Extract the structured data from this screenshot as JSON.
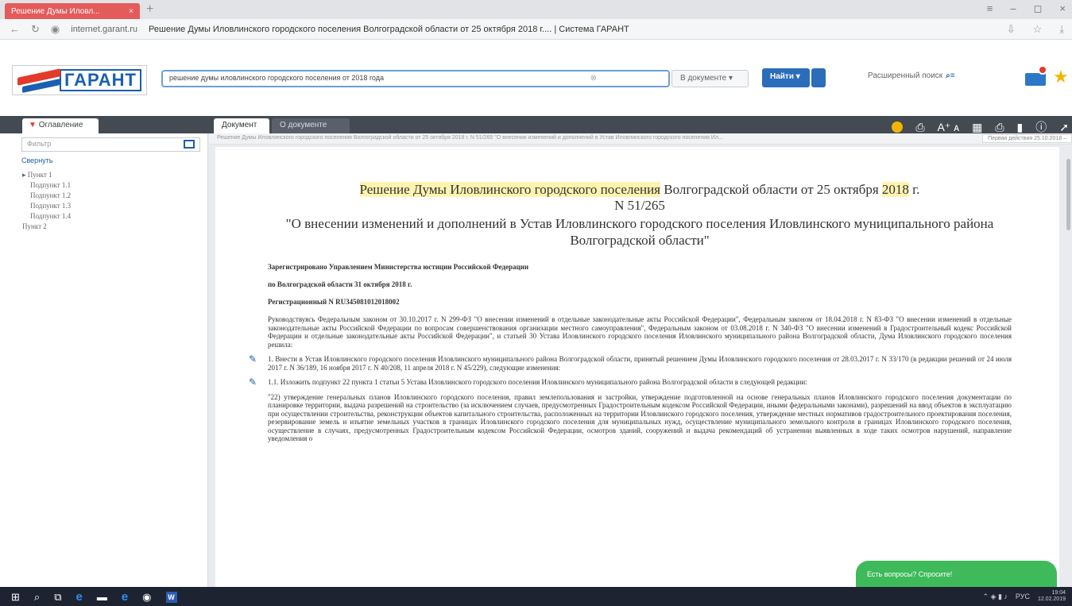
{
  "browser": {
    "tab_title": "Решение Думы Иловл...",
    "new_tab": "+",
    "url_domain": "internet.garant.ru",
    "page_title": "Решение Думы Иловлинского городского поселения Волгоградской области от 25 октября 2018 г.... | Система ГАРАНТ",
    "window_controls": [
      "≡",
      "–",
      "◻",
      "×"
    ]
  },
  "header": {
    "logo_text": "ГАРАНТ",
    "search_value": "решение думы иловлинского городского поселения от 2018 года",
    "scope_label": "В документе",
    "find_label": "Найти",
    "advanced_search": "Расширенный поиск"
  },
  "sidebar": {
    "tab_label": "Оглавление",
    "filter_placeholder": "Фильтр",
    "collapse_label": "Свернуть",
    "tree": [
      {
        "label": "Пункт 1",
        "level": 1
      },
      {
        "label": "Подпункт 1.1",
        "level": 2
      },
      {
        "label": "Подпункт 1.2",
        "level": 2
      },
      {
        "label": "Подпункт 1.3",
        "level": 2
      },
      {
        "label": "Подпункт 1.4",
        "level": 2
      },
      {
        "label": "Пункт 2",
        "level": 1
      }
    ]
  },
  "doc_tabs": {
    "document": "Документ",
    "about": "О документе"
  },
  "doc_bar": {
    "breadcrumb": "Решение Думы Иловлинского городского поселения Волгоградской области от 25 октября 2018 г. N 51/265 \"О внесении изменений и дополнений в Устав Иловлинского городского поселения Ил...",
    "edition": "Первая действия 25.10.2018 –"
  },
  "document": {
    "title_line1_hl": "Решение Думы Иловлинского городского поселения",
    "title_line1_rest": " Волгоградской области от 25 октября ",
    "title_year": "2018",
    "title_line1_end": " г.",
    "title_number": "N 51/265",
    "title_line2": "\"О внесении изменений и дополнений в Устав Иловлинского городского поселения Иловлинского муниципального района Волгоградской области\"",
    "reg_line1": "Зарегистрировано Управлением Министерства юстиции Российской Федерации",
    "reg_line2": "по Волгоградской области 31 октября 2018 г.",
    "reg_line3": "Регистрационный N RU345081012018002",
    "para1": "Руководствуясь Федеральным законом от 30.10.2017 г. N 299-ФЗ \"О внесении изменений в отдельные законодательные акты Российской Федерации\", Федеральным законом от 18.04.2018 г. N 83-ФЗ \"О внесении изменений в отдельные законодательные акты Российской Федерации по вопросам совершенствования организации местного самоуправления\", Федеральным законом от 03.08.2018 г. N 340-ФЗ \"О внесении изменений в Градостроительный кодекс Российской Федерации и отдельные законодательные акты Российской Федерации\", и статьей 30 Устава Иловлинского городского поселения Иловлинского муниципального района Волгоградской области, Дума Иловлинского городского поселения решила:",
    "para2": "1. Внести в Устав Иловлинского городского поселения Иловлинского муниципального района Волгоградской области, принятый решением Думы Иловлинского городского поселения от 28.03.2017 г. N 33/170 (в редакции решений от 24 июля 2017 г. N 36/189, 16 ноября 2017 г. N 40/208, 11 апреля 2018 г. N 45/229), следующие изменения:",
    "para3": "1.1. Изложить подпункт 22 пункта 1 статьи 5 Устава Иловлинского городского поселения Иловлинского муниципального района Волгоградской области в следующей редакции:",
    "para4": "\"22) утверждение генеральных планов Иловлинского городского поселения, правил землепользования и застройки, утверждение подготовленной на основе генеральных планов Иловлинского городского поселения документации по планировке территории, выдача разрешений на строительство (за исключением случаев, предусмотренных Градостроительным кодексом Российской Федерации, иными федеральными законами), разрешений на ввод объектов в эксплуатацию при осуществлении строительства, реконструкции объектов капитального строительства, расположенных на территории Иловлинского городского поселения, утверждение местных нормативов градостроительного проектирования поселения, резервирование земель и изъятие земельных участков в границах Иловлинского городского поселения для муниципальных нужд, осуществление муниципального земельного контроля в границах Иловлинского городского поселения, осуществление в случаях, предусмотренных Градостроительным кодексом Российской Федерации, осмотров зданий, сооружений и выдача рекомендаций об устранении выявленных в ходе таких осмотров нарушений, направление уведомления о"
  },
  "chat": {
    "label": "Есть вопросы? Спросите!"
  },
  "taskbar": {
    "lang": "РУС",
    "time": "19:04",
    "date": "12.02.2019"
  }
}
